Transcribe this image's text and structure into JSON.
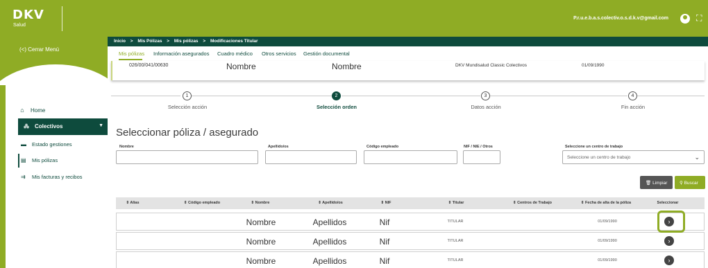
{
  "brand": {
    "name": "DKV",
    "subtitle": "Salud"
  },
  "header": {
    "user_email": "P.r.u.e.b.a.s.colectiv.o.s.d.k.v@gmail.com"
  },
  "sidebar": {
    "close_menu": "(<) Cerrar Menú",
    "home": "Home",
    "colectivos": "Colectivos",
    "sub_items": [
      "Estado gestiones",
      "Mis pólizas",
      "Mis facturas y recibos"
    ]
  },
  "breadcrumb": [
    "Inicio",
    ">",
    "Mis Pólizas",
    ">",
    "Mis pólizas",
    ">",
    "Modificaciones Titular"
  ],
  "tabs": [
    "Mis pólizas",
    "Información asegurados",
    "Cuadro médico",
    "Otros servicios",
    "Gestión documental"
  ],
  "policy": {
    "number": "026/00/041/00630",
    "name1": "Nombre",
    "name2": "Nombre",
    "product": "DKV Mundisalud Classic Colectivos",
    "date": "01/09/1990"
  },
  "steps": [
    {
      "num": "1",
      "label": "Selección acción",
      "active": false
    },
    {
      "num": "2",
      "label": "Selección orden",
      "active": true
    },
    {
      "num": "3",
      "label": "Datos acción",
      "active": false
    },
    {
      "num": "4",
      "label": "Fin acción",
      "active": false
    }
  ],
  "form": {
    "title": "Seleccionar póliza / asegurado",
    "labels": {
      "nombre": "Nombre",
      "apellidos": "Apellido/os",
      "codigo": "Código empleado",
      "nif": "NIF / NIE / Otros",
      "centro": "Seleccione un centro de trabajo"
    },
    "centro_placeholder": "Seleccione un centro de trabajo",
    "btn_limpiar": "Limpiar",
    "btn_buscar": "Buscar"
  },
  "table": {
    "headers": [
      "⇕ Alias",
      "⇕ Código empleado",
      "⇕ Nombre",
      "⇕ Apellido/os",
      "⇕ NIF",
      "⇕ Titular",
      "⇕ Centros de Trabajo",
      "⇕ Fecha de alta de la póliza",
      "Seleccionar"
    ],
    "rows": [
      {
        "nombre": "Nombre",
        "apellidos": "Apellidos",
        "nif": "Nif",
        "titular": "TITULAR",
        "fecha": "01/09/1990"
      },
      {
        "nombre": "Nombre",
        "apellidos": "Apellidos",
        "nif": "Nif",
        "titular": "TITULAR",
        "fecha": "01/09/1990"
      },
      {
        "nombre": "Nombre",
        "apellidos": "Apellidos",
        "nif": "Nif",
        "titular": "TITULAR",
        "fecha": "01/09/1990"
      }
    ]
  },
  "colors": {
    "green": "#8fac25",
    "dark_green": "#0e4b3d"
  }
}
